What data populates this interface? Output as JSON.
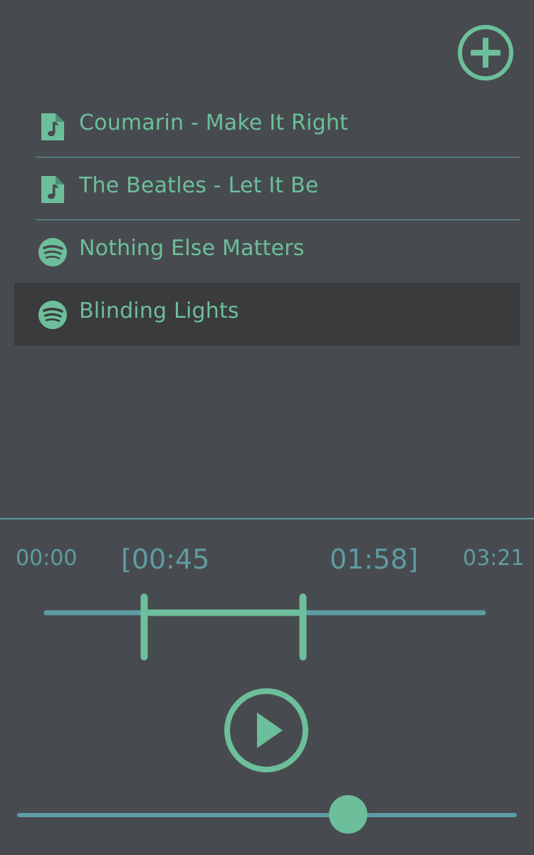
{
  "colors": {
    "background": "#474b4f",
    "selected_row": "#3a3b3d",
    "accent": "#6cbf9a",
    "secondary": "#5e9ca3"
  },
  "header": {
    "add_icon": "plus-circle-icon"
  },
  "tracks": [
    {
      "title": "Coumarin - Make It Right",
      "icon": "music-file-icon",
      "selected": false
    },
    {
      "title": "The Beatles - Let It Be",
      "icon": "music-file-icon",
      "selected": false
    },
    {
      "title": "Nothing Else Matters",
      "icon": "spotify-icon",
      "selected": false
    },
    {
      "title": "Blinding Lights",
      "icon": "spotify-icon",
      "selected": true
    }
  ],
  "player": {
    "time_start": "00:00",
    "time_end": "03:21",
    "selection_start": "[00:45",
    "selection_end": "01:58]",
    "duration_seconds": 201,
    "selection_start_seconds": 45,
    "selection_end_seconds": 118,
    "play_icon": "play-circle-icon",
    "seek_fraction": 0.663
  }
}
